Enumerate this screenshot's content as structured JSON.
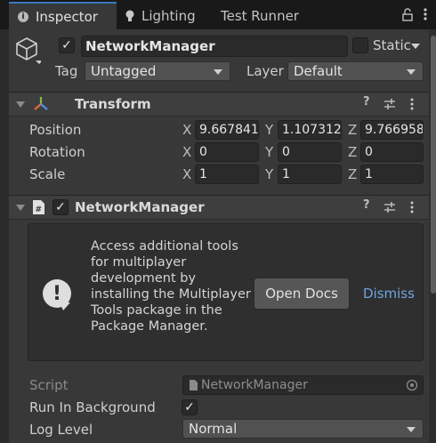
{
  "tabs": [
    {
      "label": "Inspector",
      "icon": "info-icon"
    },
    {
      "label": "Lighting",
      "icon": "lightbulb-icon"
    },
    {
      "label": "Test Runner"
    }
  ],
  "header": {
    "object_name": "NetworkManager",
    "active_checked": true,
    "static_label": "Static",
    "static_checked": false,
    "tag_label": "Tag",
    "tag_value": "Untagged",
    "layer_label": "Layer",
    "layer_value": "Default"
  },
  "transform": {
    "title": "Transform",
    "rows": [
      {
        "label": "Position",
        "x": "9.667841",
        "y": "1.107312",
        "z": "9.766958"
      },
      {
        "label": "Rotation",
        "x": "0",
        "y": "0",
        "z": "0"
      },
      {
        "label": "Scale",
        "x": "1",
        "y": "1",
        "z": "1"
      }
    ],
    "axes": [
      "X",
      "Y",
      "Z"
    ]
  },
  "network_manager": {
    "title": "NetworkManager",
    "enabled": true,
    "help_text": "Access additional tools for multiplayer development by installing the Multiplayer Tools package in the Package Manager.",
    "open_docs_label": "Open Docs",
    "dismiss_label": "Dismiss",
    "script_label": "Script",
    "script_value": "NetworkManager",
    "run_in_background_label": "Run In Background",
    "run_in_background_checked": true,
    "log_level_label": "Log Level",
    "log_level_value": "Normal"
  },
  "colors": {
    "background": "#383838",
    "tab_bar": "#191919",
    "accent_link": "#6ea4e0",
    "active_tab_border": "#3a79bb"
  }
}
